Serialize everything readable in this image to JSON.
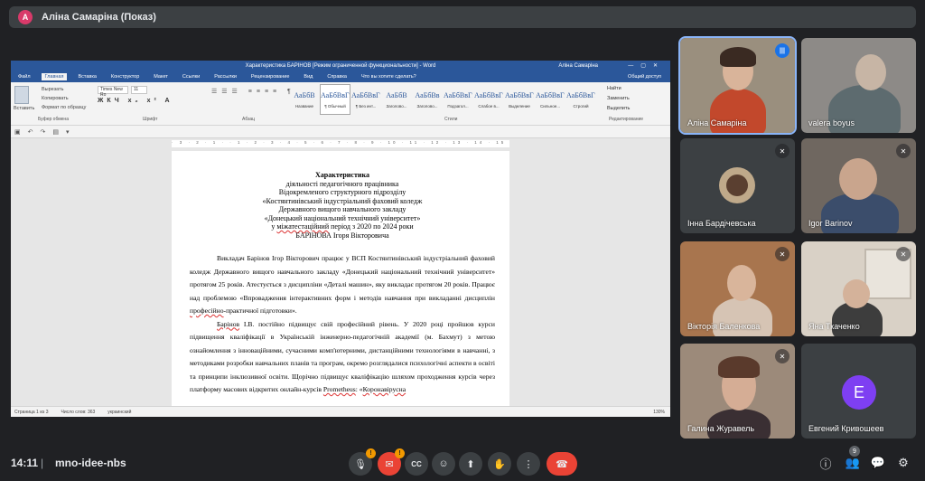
{
  "presenter": {
    "avatar_letter": "A",
    "label": "Аліна Самаріна (Показ)"
  },
  "word": {
    "title": "Характеристика БАРІНОВ [Режим ограниченной функциональности] - Word",
    "user": "Аліна Самаріна",
    "tabs": [
      "Файл",
      "Главная",
      "Вставка",
      "Конструктор",
      "Макет",
      "Ссылки",
      "Рассылки",
      "Рецензирование",
      "Вид",
      "Справка"
    ],
    "tell_me": "Что вы хотите сделать?",
    "share": "Общий доступ",
    "clipboard": {
      "paste": "Вставить",
      "cut": "Вырезать",
      "copy": "Копировать",
      "format": "Формат по образцу",
      "group": "Буфер обмена"
    },
    "font_name": "Times New Ro",
    "font_size": "11",
    "font_group": "Шрифт",
    "para_group": "Абзац",
    "styles_group": "Стили",
    "edit_group": "Редактирование",
    "styles": [
      {
        "sample": "АаБбВ",
        "name": "Название"
      },
      {
        "sample": "АаБбВвГг",
        "name": "¶ Обычный"
      },
      {
        "sample": "АаБбВвГг",
        "name": "¶ Без инт..."
      },
      {
        "sample": "АаБбВ",
        "name": "Заголово..."
      },
      {
        "sample": "АаБбВв",
        "name": "Заголово..."
      },
      {
        "sample": "АаБбВвГг",
        "name": "Подзагол..."
      },
      {
        "sample": "АаБбВвГг",
        "name": "Слабое в..."
      },
      {
        "sample": "АаБбВвГг",
        "name": "Выделение"
      },
      {
        "sample": "АаБбВвГг",
        "name": "Сильное..."
      },
      {
        "sample": "АаБбВвГг",
        "name": "Строгий"
      }
    ],
    "edit": [
      "Найти",
      "Заменить",
      "Выделить"
    ],
    "ruler": "· 3 · 2 · 1 · · 1 · 2 · 3 · 4 · 5 · 6 · 7 · 8 · 9 · 10 · 11 · 12 · 13 · 14 · 15 · 16 · 17 · 18 ·",
    "status": {
      "page": "Страница 1 из 3",
      "words": "Число слов: 363",
      "lang": "украинский",
      "zoom": "130%"
    }
  },
  "doc": {
    "heading": "Характеристика",
    "lines": [
      "діяльності педагогічного працівника",
      "Відокремленого структурного підрозділу",
      "«Костянтинівський індустріальний фаховий коледж",
      "Державного вищого навчального закладу",
      "«Донецький національний технічний університет»"
    ],
    "period_pre": "у ",
    "period_word": "міжатестаційний",
    "period_post": " період з 2020 по 2024 роки",
    "person": "БАРІНОВА Ігоря Вікторовича",
    "para1_a": "Викладач Барінов Ігор Вікторович працює у ВСП Костянтинівський індустріальний фаховий коледж Державного вищого навчального закладу «Донецький національний технічний університет» протягом 25 років. Атестується з дисципліни «Деталі машин», яку викладає протягом 20 років. Працює над проблемою «Впровадження інтерактивних форм і методів навчання при викладанні дисциплін ",
    "para1_wavy": "професійно",
    "para1_b": "-практичної підготовки».",
    "para2_wavy": "Барінов",
    "para2_a": " І.В. постійно підвищує свій професійний рівень. У 2020 році пройшов курси підвищення кваліфікації в Українській інженерно-педагогічній академії (м. Бахмут) з метою ознайомлення з інноваційними, сучасними комп'ютерними, дистанційними технологіями в навчанні, з методиками розробки навчальних планів та програм, окремо розглядалися психологічні аспекти в освіті та принципи інклюзивної освіти. Щорічно підвищує кваліфікацію шляхом проходження курсів через платформу масових відкритих онлайн-курсів ",
    "para2_wavy2": "Prometheus",
    "para2_b": ": «",
    "para2_wavy3": "Коронавірусна"
  },
  "participants": [
    {
      "name": "Аліна Самаріна",
      "speaking": true
    },
    {
      "name": "valera boyus",
      "speaking": false
    },
    {
      "name": "Інна Бардічевська",
      "muted": true
    },
    {
      "name": "Igor Barinov",
      "muted": true
    },
    {
      "name": "Вікторія Баленкова",
      "muted": true
    },
    {
      "name": "Яна Ткаченко",
      "muted": true
    },
    {
      "name": "Галина Журавель",
      "muted": true
    },
    {
      "name": "Евгений Кривошеев",
      "avatar_letter": "E"
    }
  ],
  "bottom": {
    "time": "14:11",
    "separator": "|",
    "meeting_code": "mno-idee-nbs",
    "warn_mark": "!",
    "participant_count": "9"
  },
  "colors": {
    "accent_blue": "#8ab4f8",
    "hangup_red": "#ea4335",
    "word_blue": "#2b579a",
    "avatar_purple": "#7e3ff2"
  }
}
